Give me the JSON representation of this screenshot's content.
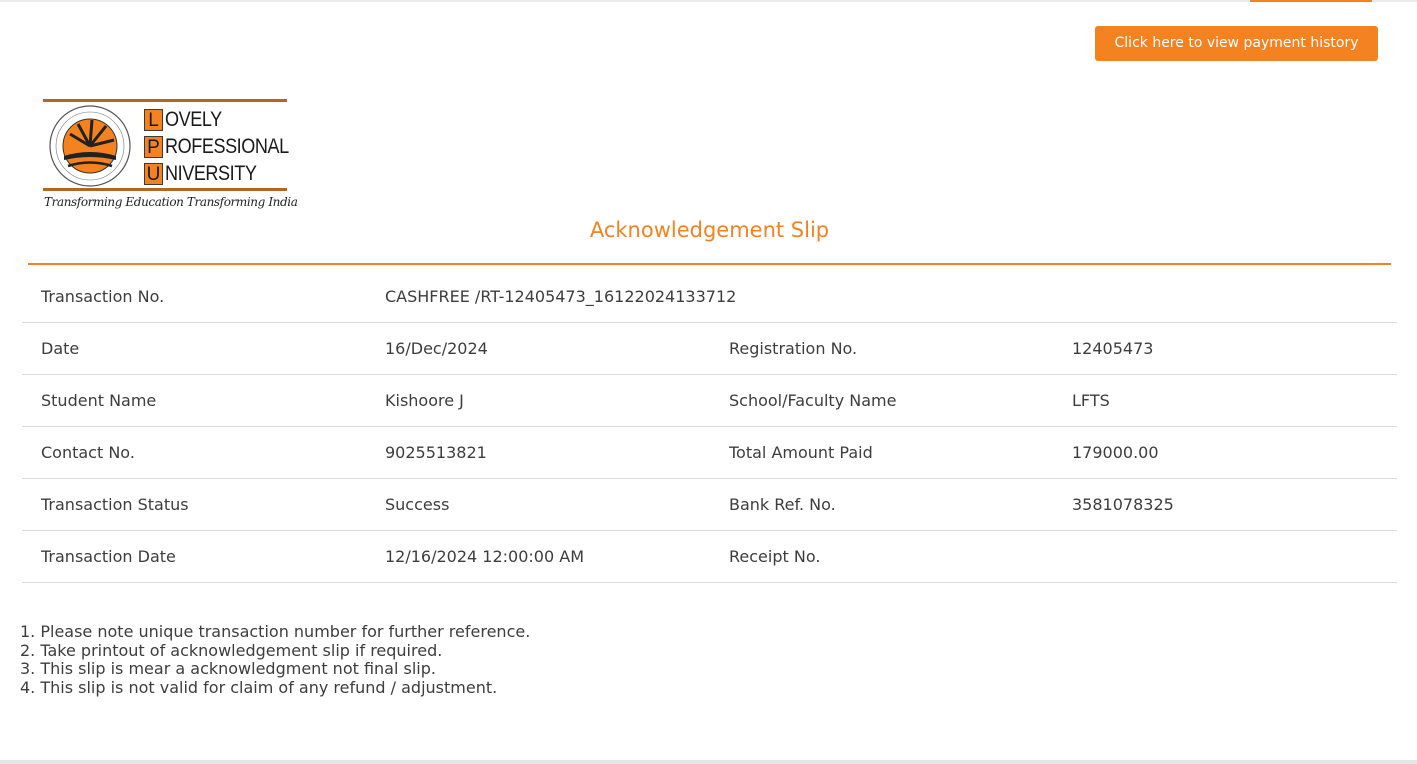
{
  "header": {
    "history_button_label": "Click here to view payment history"
  },
  "logo": {
    "letters": [
      "L",
      "P",
      "U"
    ],
    "words": [
      "OVELY",
      "ROFESSIONAL",
      "NIVERSITY"
    ],
    "tagline": "Transforming Education Transforming India"
  },
  "slip": {
    "title": "Acknowledgement Slip",
    "rows": [
      {
        "label1": "Transaction No.",
        "value1": "CASHFREE /RT-12405473_16122024133712",
        "label2": "",
        "value2": ""
      },
      {
        "label1": "Date",
        "value1": "16/Dec/2024",
        "label2": "Registration No.",
        "value2": "12405473"
      },
      {
        "label1": "Student Name",
        "value1": "Kishoore J",
        "label2": "School/Faculty Name",
        "value2": "LFTS"
      },
      {
        "label1": "Contact No.",
        "value1": "9025513821",
        "label2": "Total Amount Paid",
        "value2": "179000.00"
      },
      {
        "label1": "Transaction Status",
        "value1": "Success",
        "label2": "Bank Ref. No.",
        "value2": "3581078325"
      },
      {
        "label1": "Transaction Date",
        "value1": "12/16/2024 12:00:00 AM",
        "label2": "Receipt No.",
        "value2": ""
      }
    ]
  },
  "notes": [
    "1. Please note unique transaction number for further reference.",
    "2. Take printout of acknowledgement slip if required.",
    "3. This slip is mear a acknowledgment not final slip.",
    "4. This slip is not valid for claim of any refund / adjustment."
  ],
  "colors": {
    "accent": "#f58220",
    "text": "#3d3d3d",
    "divider": "#dcdcdc"
  }
}
